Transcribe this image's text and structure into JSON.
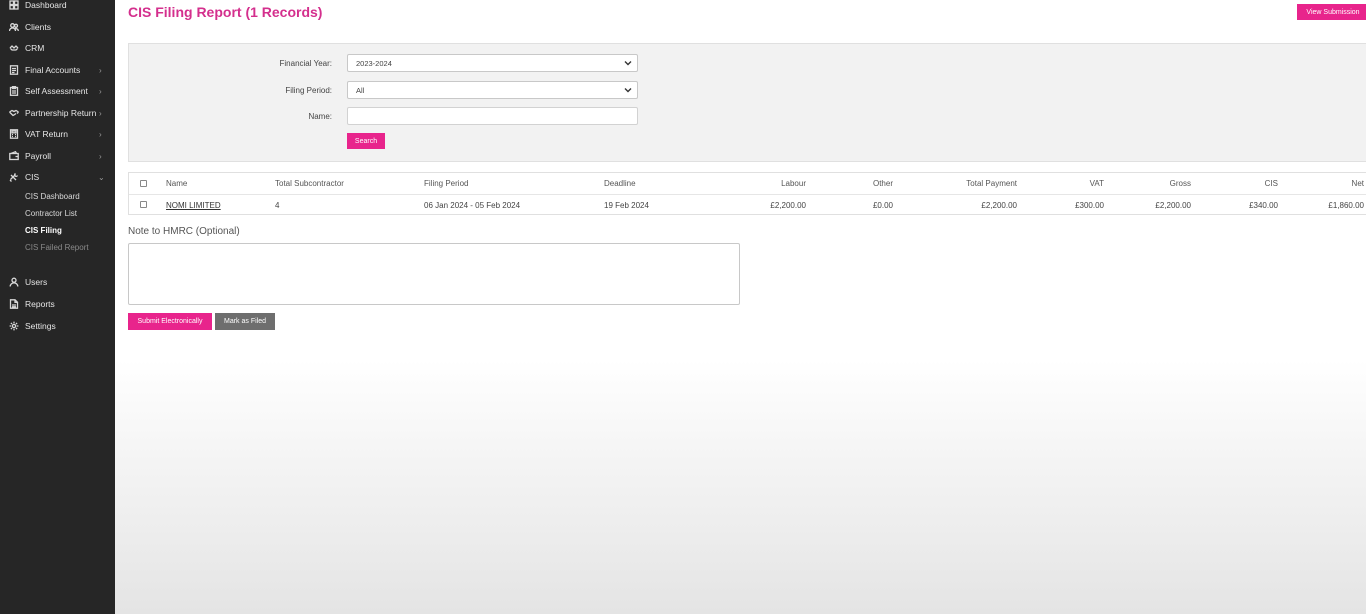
{
  "sidebar": {
    "items": [
      {
        "label": "Dashboard",
        "icon": "dashboard-icon"
      },
      {
        "label": "Clients",
        "icon": "users-icon"
      },
      {
        "label": "CRM",
        "icon": "crm-icon"
      },
      {
        "label": "Final Accounts",
        "icon": "document-icon"
      },
      {
        "label": "Self Assessment",
        "icon": "clipboard-icon"
      },
      {
        "label": "Partnership Return",
        "icon": "handshake-icon"
      },
      {
        "label": "VAT Return",
        "icon": "calculator-icon"
      },
      {
        "label": "Payroll",
        "icon": "wallet-icon"
      },
      {
        "label": "CIS",
        "icon": "tools-icon"
      }
    ],
    "cis_sub": [
      "CIS Dashboard",
      "Contractor List",
      "CIS Filing",
      "CIS Failed Report"
    ],
    "bottom_items": [
      {
        "label": "Users",
        "icon": "user-icon"
      },
      {
        "label": "Reports",
        "icon": "report-icon"
      },
      {
        "label": "Settings",
        "icon": "gear-icon"
      }
    ]
  },
  "header": {
    "title": "CIS Filing Report (1 Records)",
    "view_submission": "View Submission"
  },
  "filters": {
    "financial_year_label": "Financial Year:",
    "financial_year_value": "2023-2024",
    "filing_period_label": "Filing Period:",
    "filing_period_value": "All",
    "name_label": "Name:",
    "name_value": "",
    "search_button": "Search"
  },
  "table": {
    "columns": [
      "Name",
      "Total Subcontractor",
      "Filing Period",
      "Deadline",
      "Labour",
      "Other",
      "Total Payment",
      "VAT",
      "Gross",
      "CIS",
      "Net"
    ],
    "rows": [
      [
        "NOMI LIMITED",
        "4",
        "06 Jan 2024 - 05 Feb 2024",
        "19 Feb 2024",
        "£2,200.00",
        "£0.00",
        "£2,200.00",
        "£300.00",
        "£2,200.00",
        "£340.00",
        "£1,860.00"
      ]
    ]
  },
  "note": {
    "label": "Note to HMRC (Optional)",
    "value": ""
  },
  "actions": {
    "submit": "Submit Electronically",
    "mark_filed": "Mark as Filed"
  },
  "colors": {
    "accent": "#e8248c",
    "title": "#d42f8d",
    "sidebar_bg": "#262626",
    "secondary_button": "#6e6e6e"
  }
}
